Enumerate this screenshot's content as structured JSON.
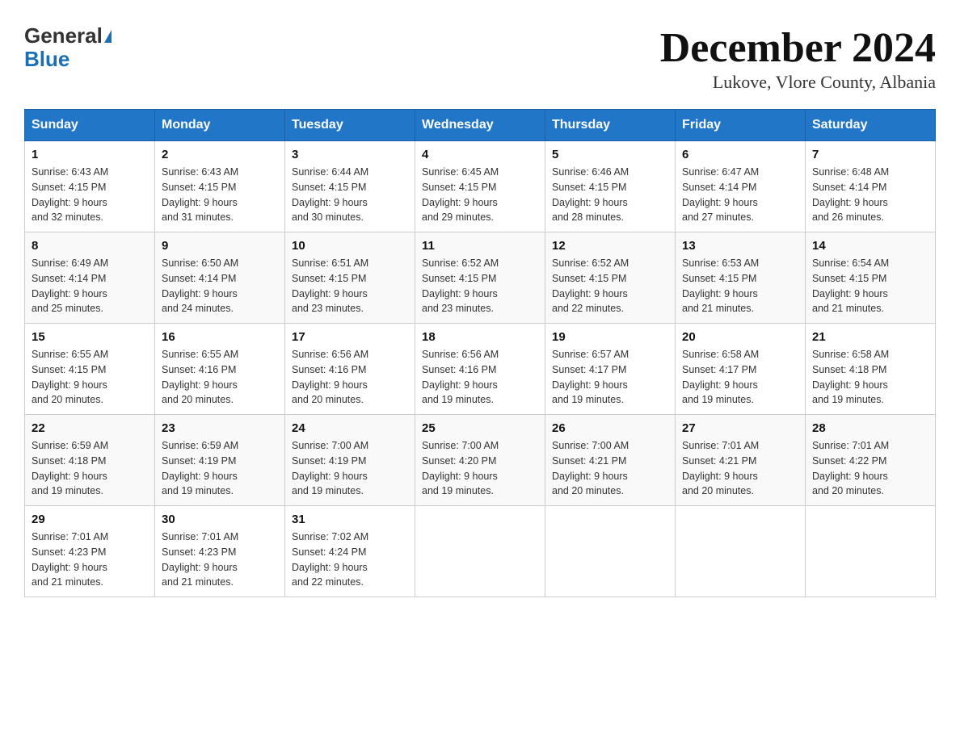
{
  "header": {
    "logo_line1": "General",
    "logo_line2": "Blue",
    "main_title": "December 2024",
    "subtitle": "Lukove, Vlore County, Albania"
  },
  "days_of_week": [
    "Sunday",
    "Monday",
    "Tuesday",
    "Wednesday",
    "Thursday",
    "Friday",
    "Saturday"
  ],
  "weeks": [
    [
      {
        "day": "1",
        "sunrise": "6:43 AM",
        "sunset": "4:15 PM",
        "daylight": "9 hours and 32 minutes."
      },
      {
        "day": "2",
        "sunrise": "6:43 AM",
        "sunset": "4:15 PM",
        "daylight": "9 hours and 31 minutes."
      },
      {
        "day": "3",
        "sunrise": "6:44 AM",
        "sunset": "4:15 PM",
        "daylight": "9 hours and 30 minutes."
      },
      {
        "day": "4",
        "sunrise": "6:45 AM",
        "sunset": "4:15 PM",
        "daylight": "9 hours and 29 minutes."
      },
      {
        "day": "5",
        "sunrise": "6:46 AM",
        "sunset": "4:15 PM",
        "daylight": "9 hours and 28 minutes."
      },
      {
        "day": "6",
        "sunrise": "6:47 AM",
        "sunset": "4:14 PM",
        "daylight": "9 hours and 27 minutes."
      },
      {
        "day": "7",
        "sunrise": "6:48 AM",
        "sunset": "4:14 PM",
        "daylight": "9 hours and 26 minutes."
      }
    ],
    [
      {
        "day": "8",
        "sunrise": "6:49 AM",
        "sunset": "4:14 PM",
        "daylight": "9 hours and 25 minutes."
      },
      {
        "day": "9",
        "sunrise": "6:50 AM",
        "sunset": "4:14 PM",
        "daylight": "9 hours and 24 minutes."
      },
      {
        "day": "10",
        "sunrise": "6:51 AM",
        "sunset": "4:15 PM",
        "daylight": "9 hours and 23 minutes."
      },
      {
        "day": "11",
        "sunrise": "6:52 AM",
        "sunset": "4:15 PM",
        "daylight": "9 hours and 23 minutes."
      },
      {
        "day": "12",
        "sunrise": "6:52 AM",
        "sunset": "4:15 PM",
        "daylight": "9 hours and 22 minutes."
      },
      {
        "day": "13",
        "sunrise": "6:53 AM",
        "sunset": "4:15 PM",
        "daylight": "9 hours and 21 minutes."
      },
      {
        "day": "14",
        "sunrise": "6:54 AM",
        "sunset": "4:15 PM",
        "daylight": "9 hours and 21 minutes."
      }
    ],
    [
      {
        "day": "15",
        "sunrise": "6:55 AM",
        "sunset": "4:15 PM",
        "daylight": "9 hours and 20 minutes."
      },
      {
        "day": "16",
        "sunrise": "6:55 AM",
        "sunset": "4:16 PM",
        "daylight": "9 hours and 20 minutes."
      },
      {
        "day": "17",
        "sunrise": "6:56 AM",
        "sunset": "4:16 PM",
        "daylight": "9 hours and 20 minutes."
      },
      {
        "day": "18",
        "sunrise": "6:56 AM",
        "sunset": "4:16 PM",
        "daylight": "9 hours and 19 minutes."
      },
      {
        "day": "19",
        "sunrise": "6:57 AM",
        "sunset": "4:17 PM",
        "daylight": "9 hours and 19 minutes."
      },
      {
        "day": "20",
        "sunrise": "6:58 AM",
        "sunset": "4:17 PM",
        "daylight": "9 hours and 19 minutes."
      },
      {
        "day": "21",
        "sunrise": "6:58 AM",
        "sunset": "4:18 PM",
        "daylight": "9 hours and 19 minutes."
      }
    ],
    [
      {
        "day": "22",
        "sunrise": "6:59 AM",
        "sunset": "4:18 PM",
        "daylight": "9 hours and 19 minutes."
      },
      {
        "day": "23",
        "sunrise": "6:59 AM",
        "sunset": "4:19 PM",
        "daylight": "9 hours and 19 minutes."
      },
      {
        "day": "24",
        "sunrise": "7:00 AM",
        "sunset": "4:19 PM",
        "daylight": "9 hours and 19 minutes."
      },
      {
        "day": "25",
        "sunrise": "7:00 AM",
        "sunset": "4:20 PM",
        "daylight": "9 hours and 19 minutes."
      },
      {
        "day": "26",
        "sunrise": "7:00 AM",
        "sunset": "4:21 PM",
        "daylight": "9 hours and 20 minutes."
      },
      {
        "day": "27",
        "sunrise": "7:01 AM",
        "sunset": "4:21 PM",
        "daylight": "9 hours and 20 minutes."
      },
      {
        "day": "28",
        "sunrise": "7:01 AM",
        "sunset": "4:22 PM",
        "daylight": "9 hours and 20 minutes."
      }
    ],
    [
      {
        "day": "29",
        "sunrise": "7:01 AM",
        "sunset": "4:23 PM",
        "daylight": "9 hours and 21 minutes."
      },
      {
        "day": "30",
        "sunrise": "7:01 AM",
        "sunset": "4:23 PM",
        "daylight": "9 hours and 21 minutes."
      },
      {
        "day": "31",
        "sunrise": "7:02 AM",
        "sunset": "4:24 PM",
        "daylight": "9 hours and 22 minutes."
      },
      null,
      null,
      null,
      null
    ]
  ],
  "labels": {
    "sunrise": "Sunrise:",
    "sunset": "Sunset:",
    "daylight": "Daylight:"
  }
}
